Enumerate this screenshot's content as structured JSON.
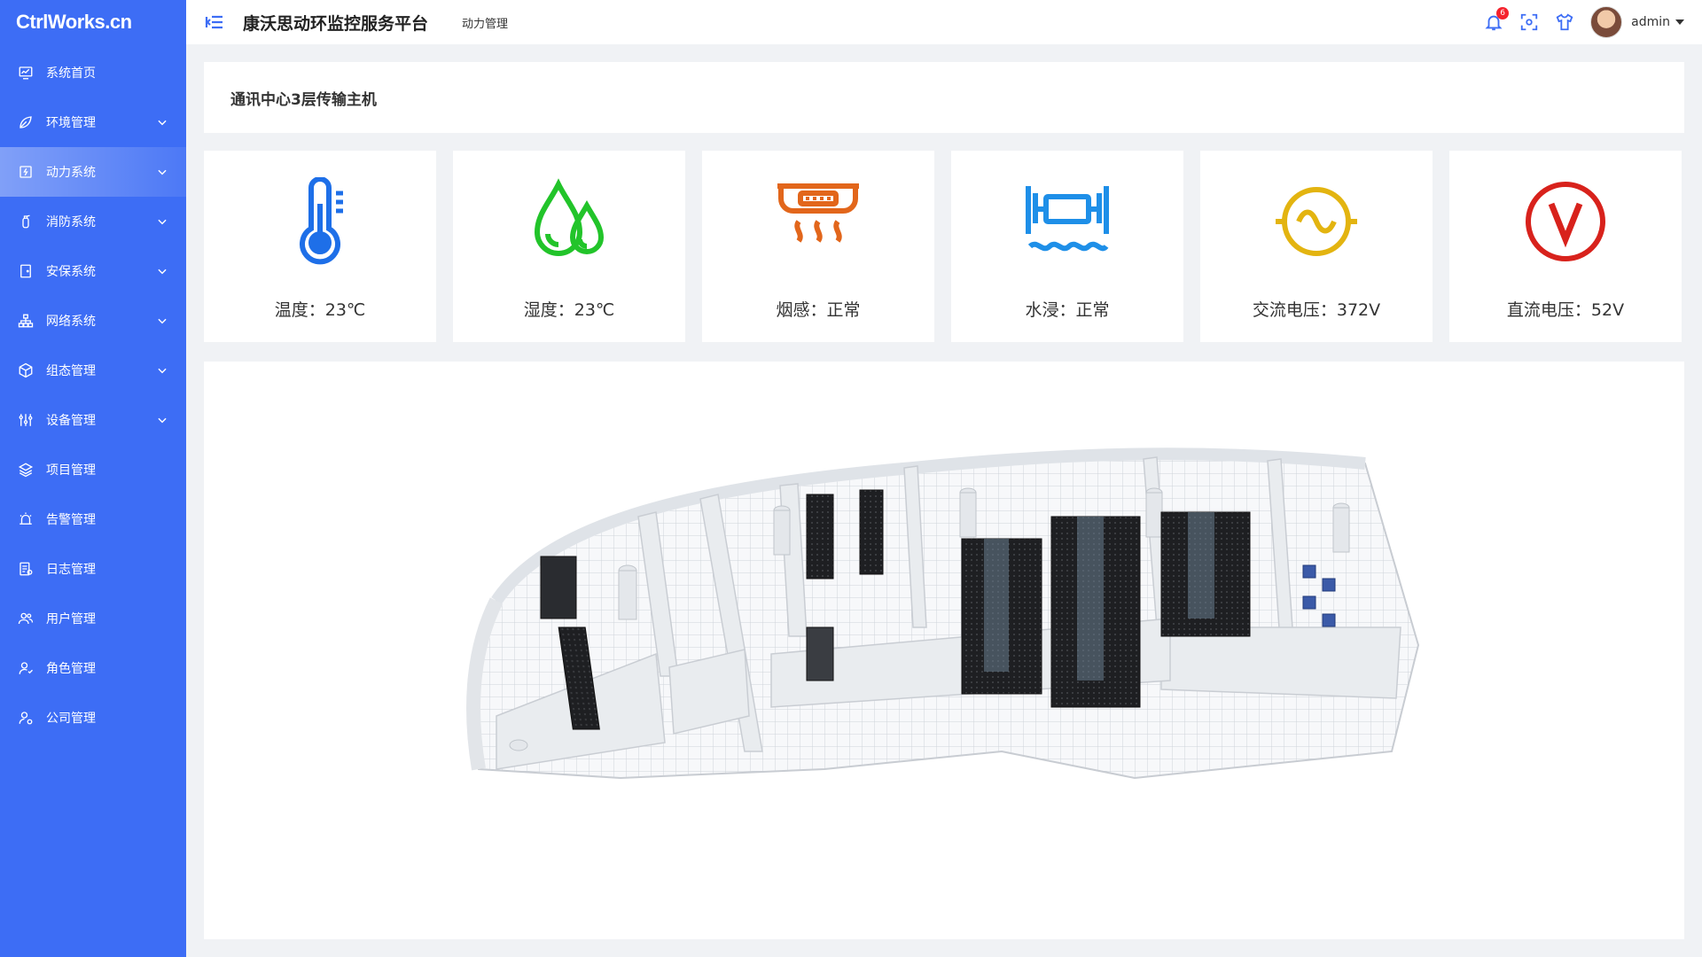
{
  "app": {
    "logo": "CtrlWorks.cn",
    "title": "康沃思动环监控服务平台",
    "breadcrumb": "动力管理",
    "username": "admin",
    "notification_count": "6",
    "accent_color": "#3d6df5"
  },
  "sidebar": {
    "items": [
      {
        "label": "系统首页",
        "icon": "monitor-chart-icon",
        "expandable": false
      },
      {
        "label": "环境管理",
        "icon": "leaf-icon",
        "expandable": true
      },
      {
        "label": "动力系统",
        "icon": "power-box-icon",
        "expandable": true,
        "active": true
      },
      {
        "label": "消防系统",
        "icon": "fire-extinguisher-icon",
        "expandable": true
      },
      {
        "label": "安保系统",
        "icon": "door-icon",
        "expandable": true
      },
      {
        "label": "网络系统",
        "icon": "network-icon",
        "expandable": true
      },
      {
        "label": "组态管理",
        "icon": "cube-icon",
        "expandable": true
      },
      {
        "label": "设备管理",
        "icon": "sliders-icon",
        "expandable": true
      },
      {
        "label": "项目管理",
        "icon": "layers-icon",
        "expandable": false
      },
      {
        "label": "告警管理",
        "icon": "alarm-icon",
        "expandable": false
      },
      {
        "label": "日志管理",
        "icon": "log-icon",
        "expandable": false
      },
      {
        "label": "用户管理",
        "icon": "users-icon",
        "expandable": false
      },
      {
        "label": "角色管理",
        "icon": "role-icon",
        "expandable": false
      },
      {
        "label": "公司管理",
        "icon": "company-user-icon",
        "expandable": false
      }
    ]
  },
  "page": {
    "title": "通讯中心3层传输主机"
  },
  "sensors": [
    {
      "name": "温度",
      "value": "23℃",
      "label": "温度：23℃",
      "icon": "thermometer-icon",
      "color": "#1e6fe8"
    },
    {
      "name": "湿度",
      "value": "23℃",
      "label": "湿度：23℃",
      "icon": "humidity-drops-icon",
      "color": "#22c42a"
    },
    {
      "name": "烟感",
      "value": "正常",
      "label": "烟感：正常",
      "icon": "smoke-detector-icon",
      "color": "#e2661b"
    },
    {
      "name": "水浸",
      "value": "正常",
      "label": "水浸：正常",
      "icon": "water-leak-icon",
      "color": "#1e8fe8"
    },
    {
      "name": "交流电压",
      "value": "372V",
      "label": "交流电压：372V",
      "icon": "ac-voltage-icon",
      "color": "#e3b410"
    },
    {
      "name": "直流电压",
      "value": "52V",
      "label": "直流电压：52V",
      "icon": "dc-voltage-icon",
      "color": "#d8221c"
    }
  ]
}
